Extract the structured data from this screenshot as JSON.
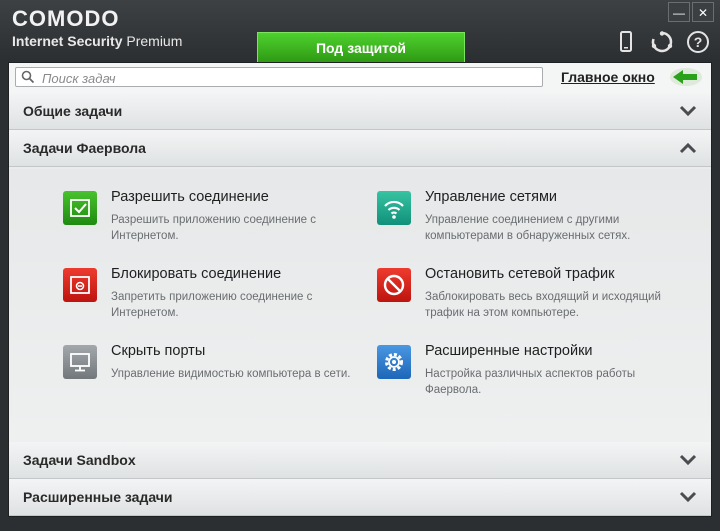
{
  "brand": {
    "logo": "COMODO",
    "product": "Internet Security",
    "edition": "Premium"
  },
  "window_controls": {
    "minimize": "—",
    "close": "✕"
  },
  "status": {
    "label": "Под защитой",
    "color": "#36a81b"
  },
  "top_icons": [
    "mobile-icon",
    "refresh-support-icon",
    "help-icon"
  ],
  "search": {
    "placeholder": "Поиск задач"
  },
  "main_window_link": "Главное окно",
  "sections": [
    {
      "title": "Общие задачи",
      "expanded": false
    },
    {
      "title": "Задачи Фаервола",
      "expanded": true
    },
    {
      "title": "Задачи Sandbox",
      "expanded": false
    },
    {
      "title": "Расширенные задачи",
      "expanded": false
    }
  ],
  "firewall_tasks": [
    {
      "title": "Разрешить соединение",
      "desc": "Разрешить приложению соединение с Интернетом.",
      "icon": "allow-connection-icon",
      "color": "#2da01b"
    },
    {
      "title": "Управление сетями",
      "desc": "Управление соединением с другими компьютерами в обнаруженных сетях.",
      "icon": "wifi-icon",
      "color": "#1fa58a"
    },
    {
      "title": "Блокировать соединение",
      "desc": "Запретить приложению соединение с Интернетом.",
      "icon": "block-connection-icon",
      "color": "#d9241c"
    },
    {
      "title": "Остановить сетевой трафик",
      "desc": "Заблокировать весь входящий и исходящий трафик на этом компьютере.",
      "icon": "stop-traffic-icon",
      "color": "#d9241c"
    },
    {
      "title": "Скрыть порты",
      "desc": "Управление видимостью компьютера в сети.",
      "icon": "stealth-ports-icon",
      "color": "#8a8f94"
    },
    {
      "title": "Расширенные настройки",
      "desc": "Настройка различных аспектов работы Фаервола.",
      "icon": "gear-icon",
      "color": "#2f7fd1"
    }
  ]
}
